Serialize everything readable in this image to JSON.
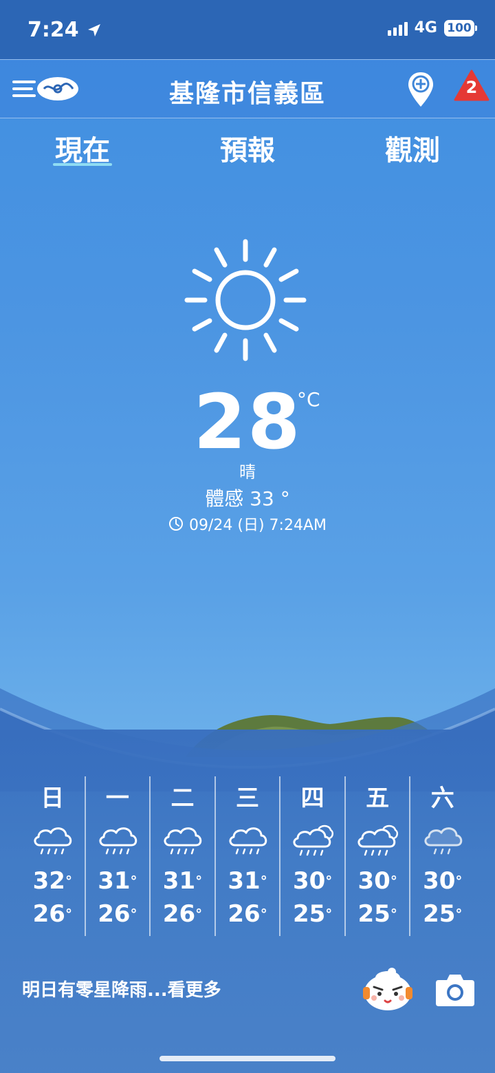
{
  "status_bar": {
    "time": "7:24",
    "network": "4G",
    "battery": "100"
  },
  "header": {
    "title": "基隆市信義區",
    "alert_count": "2"
  },
  "tabs": [
    {
      "label": "現在"
    },
    {
      "label": "預報"
    },
    {
      "label": "觀測"
    }
  ],
  "current": {
    "icon": "sun-icon",
    "temperature": "28",
    "unit": "°C",
    "condition": "晴",
    "feels_like": "體感 33 °",
    "timestamp": "09/24 (日) 7:24AM"
  },
  "forecast": [
    {
      "day": "日",
      "icon": "rain-cloud-icon",
      "high": "32",
      "low": "26"
    },
    {
      "day": "一",
      "icon": "rain-cloud-icon",
      "high": "31",
      "low": "26"
    },
    {
      "day": "二",
      "icon": "rain-cloud-icon",
      "high": "31",
      "low": "26"
    },
    {
      "day": "三",
      "icon": "rain-cloud-icon",
      "high": "31",
      "low": "26"
    },
    {
      "day": "四",
      "icon": "partly-rain-icon",
      "high": "30",
      "low": "25"
    },
    {
      "day": "五",
      "icon": "partly-rain-icon",
      "high": "30",
      "low": "25"
    },
    {
      "day": "六",
      "icon": "light-rain-icon",
      "high": "30",
      "low": "25"
    }
  ],
  "summary": "明日有零星降雨...看更多",
  "colors": {
    "header": "#2c66b5",
    "tab_accent": "#8fdcf3",
    "alert": "#e53935"
  }
}
